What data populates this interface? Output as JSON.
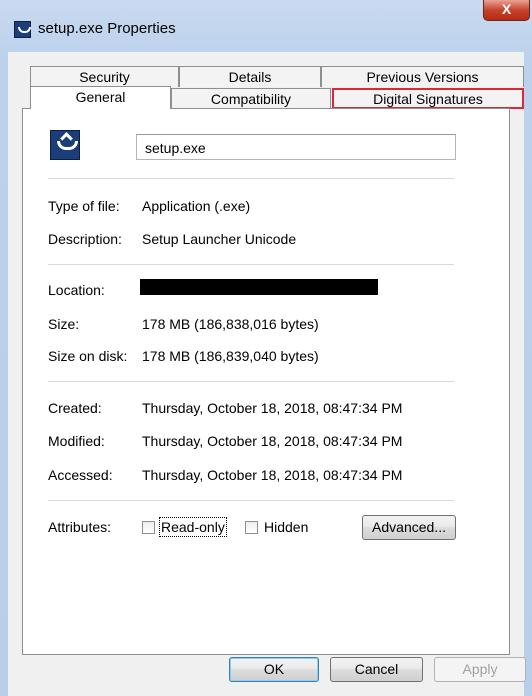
{
  "window": {
    "title": "setup.exe Properties",
    "close_label": "X"
  },
  "tabs": {
    "security": "Security",
    "details": "Details",
    "previous_versions": "Previous Versions",
    "general": "General",
    "compatibility": "Compatibility",
    "digital_signatures": "Digital Signatures"
  },
  "general": {
    "file_name": "setup.exe",
    "type_label": "Type of file:",
    "type_value": "Application (.exe)",
    "description_label": "Description:",
    "description_value": "Setup Launcher Unicode",
    "location_label": "Location:",
    "size_label": "Size:",
    "size_value": "178 MB (186,838,016 bytes)",
    "size_on_disk_label": "Size on disk:",
    "size_on_disk_value": "178 MB (186,839,040 bytes)",
    "created_label": "Created:",
    "created_value": "Thursday, October 18, 2018, 08:47:34 PM",
    "modified_label": "Modified:",
    "modified_value": "Thursday, October 18, 2018, 08:47:34 PM",
    "accessed_label": "Accessed:",
    "accessed_value": "Thursday, October 18, 2018, 08:47:34 PM",
    "attributes_label": "Attributes:",
    "readonly_label": "Read-only",
    "hidden_label": "Hidden",
    "advanced_label": "Advanced..."
  },
  "buttons": {
    "ok": "OK",
    "cancel": "Cancel",
    "apply": "Apply"
  },
  "colors": {
    "highlight": "#d82a33",
    "close_button": "#c7432c",
    "frame": "#bcd1ec"
  },
  "icons": {
    "app": "installer-icon",
    "close": "close-icon"
  }
}
